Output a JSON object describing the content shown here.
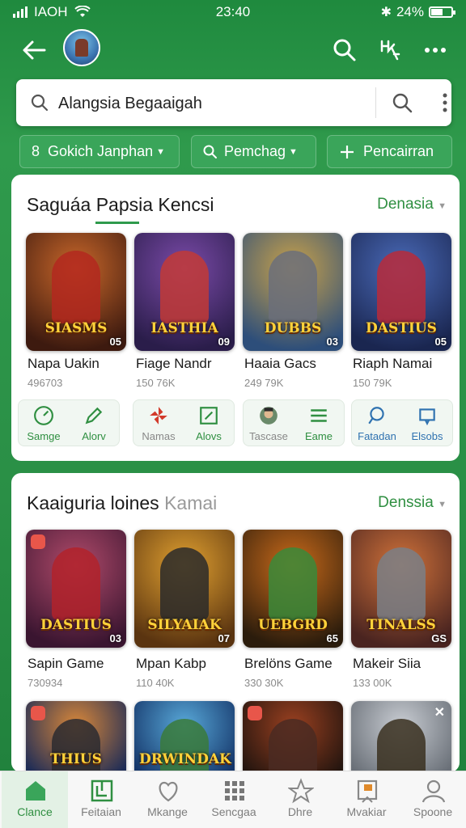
{
  "status": {
    "carrier": "IAOH",
    "time": "23:40",
    "battery": "24%"
  },
  "search": {
    "query": "Alangsia Begaaigah"
  },
  "filters": [
    {
      "label": "Gokich Janphan",
      "lead": "8"
    },
    {
      "label": "Pemchag"
    },
    {
      "label": "Pencairran"
    }
  ],
  "section1": {
    "title": "Saguáa Papsia Kencsi",
    "link": "Denasia",
    "apps": [
      {
        "name": "Napa Uakin",
        "count": "496703",
        "logo": "SIASMS",
        "badge": "05",
        "bg1": "#3d1a0f",
        "bg2": "#c9672a",
        "fig": "#b3281f"
      },
      {
        "name": "Fiage Nandr",
        "count": "150 76K",
        "logo": "IASTHIA",
        "badge": "09",
        "bg1": "#2a1d4a",
        "bg2": "#7a4aa8",
        "fig": "#c23a36"
      },
      {
        "name": "Haaia Gacs",
        "count": "249 79K",
        "logo": "DUBBS",
        "badge": "03",
        "bg1": "#2d4e7a",
        "bg2": "#c9a24a",
        "fig": "#6b6f7a"
      },
      {
        "name": "Riaph Namai",
        "count": "150 79K",
        "logo": "DASTIUS",
        "badge": "05",
        "bg1": "#1a2650",
        "bg2": "#4a6ab8",
        "fig": "#b82a3a"
      }
    ],
    "actions": [
      [
        {
          "label": "Samge",
          "icon": "gauge-icon"
        },
        {
          "label": "Alorv",
          "icon": "pencil-icon"
        }
      ],
      [
        {
          "label": "Namas",
          "icon": "pinwheel-icon"
        },
        {
          "label": "Alovs",
          "icon": "edit-square-icon"
        }
      ],
      [
        {
          "label": "Tascase",
          "icon": "face-thumbnail-icon"
        },
        {
          "label": "Eame",
          "icon": "menu-icon"
        }
      ],
      [
        {
          "label": "Fatadan",
          "icon": "search-icon"
        },
        {
          "label": "Elsobs",
          "icon": "frame-icon"
        }
      ]
    ]
  },
  "section2": {
    "title": "Kaaiguria loines",
    "title_muted": "Kamai",
    "link": "Denssia",
    "apps": [
      {
        "name": "Sapin Game",
        "count": "730934",
        "logo": "DASTIUS",
        "badge": "03",
        "bg1": "#3a1530",
        "bg2": "#b04a6a",
        "fig": "#b2222a"
      },
      {
        "name": "Mpan Kabp",
        "count": "110 40K",
        "logo": "SILYAIAK",
        "badge": "07",
        "bg1": "#5a3410",
        "bg2": "#e0a030",
        "fig": "#2a2a2a"
      },
      {
        "name": "Brelöns Game",
        "count": "330 30K",
        "logo": "UEBGRD",
        "badge": "65",
        "bg1": "#2b1c0c",
        "bg2": "#c96a1a",
        "fig": "#3a8a3a"
      },
      {
        "name": "Makeir Siia",
        "count": "133 00K",
        "logo": "TINALSS",
        "badge": "GS",
        "bg1": "#4a2420",
        "bg2": "#d0723a",
        "fig": "#7a7f86"
      }
    ],
    "row2": [
      {
        "logo": "THIUS",
        "bg1": "#1e2c56",
        "bg2": "#d8873a",
        "fig": "#2a2a30"
      },
      {
        "logo": "DRWINDAK",
        "bg1": "#15366a",
        "bg2": "#58a8d8",
        "fig": "#3a7a3a"
      },
      {
        "logo": "",
        "bg1": "#24150f",
        "bg2": "#9a4020",
        "fig": "#4a2a22"
      },
      {
        "logo": "",
        "bg1": "#6a7078",
        "bg2": "#c8ccd2",
        "fig": "#3a3020"
      }
    ]
  },
  "nav": [
    {
      "label": "Clance",
      "icon": "home-icon",
      "active": true
    },
    {
      "label": "Feitaian",
      "icon": "grid-frame-icon",
      "active": false
    },
    {
      "label": "Mkange",
      "icon": "heart-icon",
      "active": false
    },
    {
      "label": "Sencgaa",
      "icon": "apps-icon",
      "active": false
    },
    {
      "label": "Dhre",
      "icon": "star-icon",
      "active": false
    },
    {
      "label": "Mvakiar",
      "icon": "flag-icon",
      "active": false
    },
    {
      "label": "Spoone",
      "icon": "person-icon",
      "active": false
    }
  ],
  "colors": {
    "accent": "#2f9a4c",
    "header": "#1f8a3e",
    "text_link": "#2f8f41"
  }
}
